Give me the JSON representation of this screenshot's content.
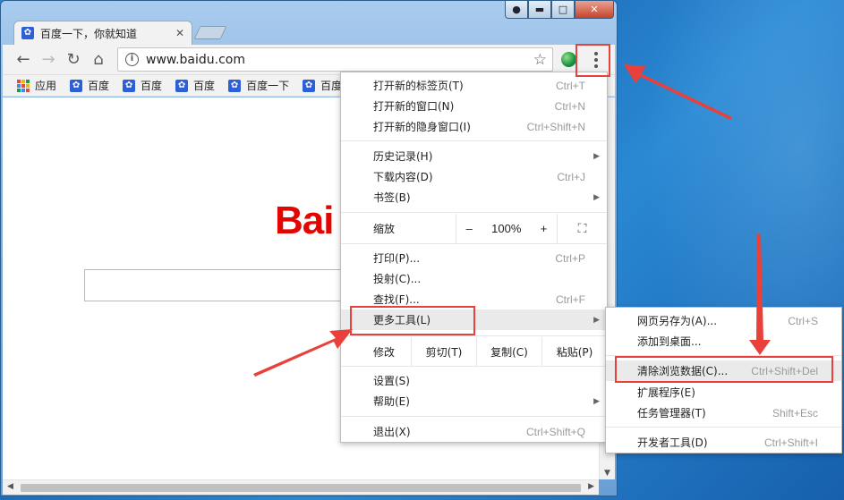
{
  "browser": {
    "tab_title": "百度一下，你就知道",
    "tab_favicon": "paw-icon",
    "url": "www.baidu.com",
    "caption_buttons": [
      "user-icon",
      "minimize-icon",
      "maximize-icon",
      "close-icon"
    ]
  },
  "bookmarks": [
    {
      "label": "应用",
      "icon": "apps-grid-icon"
    },
    {
      "label": "百度",
      "icon": "paw-icon"
    },
    {
      "label": "百度",
      "icon": "paw-icon"
    },
    {
      "label": "百度",
      "icon": "paw-icon"
    },
    {
      "label": "百度一下",
      "icon": "paw-icon"
    },
    {
      "label": "百度一",
      "icon": "paw-icon"
    }
  ],
  "page": {
    "logo_text": "Bai"
  },
  "menu": {
    "new_tab": {
      "label": "打开新的标签页(T)",
      "shortcut": "Ctrl+T"
    },
    "new_window": {
      "label": "打开新的窗口(N)",
      "shortcut": "Ctrl+N"
    },
    "new_incognito": {
      "label": "打开新的隐身窗口(I)",
      "shortcut": "Ctrl+Shift+N"
    },
    "history": {
      "label": "历史记录(H)"
    },
    "downloads": {
      "label": "下载内容(D)",
      "shortcut": "Ctrl+J"
    },
    "bookmarks": {
      "label": "书签(B)"
    },
    "zoom": {
      "label": "缩放",
      "minus": "–",
      "value": "100%",
      "plus": "+"
    },
    "print": {
      "label": "打印(P)...",
      "shortcut": "Ctrl+P"
    },
    "cast": {
      "label": "投射(C)..."
    },
    "find": {
      "label": "查找(F)...",
      "shortcut": "Ctrl+F"
    },
    "more_tools": {
      "label": "更多工具(L)"
    },
    "edit": {
      "label": "修改",
      "cut": "剪切(T)",
      "copy": "复制(C)",
      "paste": "粘贴(P)"
    },
    "settings": {
      "label": "设置(S)"
    },
    "help": {
      "label": "帮助(E)"
    },
    "exit": {
      "label": "退出(X)",
      "shortcut": "Ctrl+Shift+Q"
    }
  },
  "submenu": {
    "save_page": {
      "label": "网页另存为(A)...",
      "shortcut": "Ctrl+S"
    },
    "add_desktop": {
      "label": "添加到桌面..."
    },
    "clear_data": {
      "label": "清除浏览数据(C)...",
      "shortcut": "Ctrl+Shift+Del"
    },
    "extensions": {
      "label": "扩展程序(E)"
    },
    "task_manager": {
      "label": "任务管理器(T)",
      "shortcut": "Shift+Esc"
    },
    "dev_tools": {
      "label": "开发者工具(D)",
      "shortcut": "Ctrl+Shift+I"
    }
  },
  "colors": {
    "annotation_red": "#e8413c",
    "baidu_red": "#e10602",
    "desktop_blue": "#2277c4"
  }
}
